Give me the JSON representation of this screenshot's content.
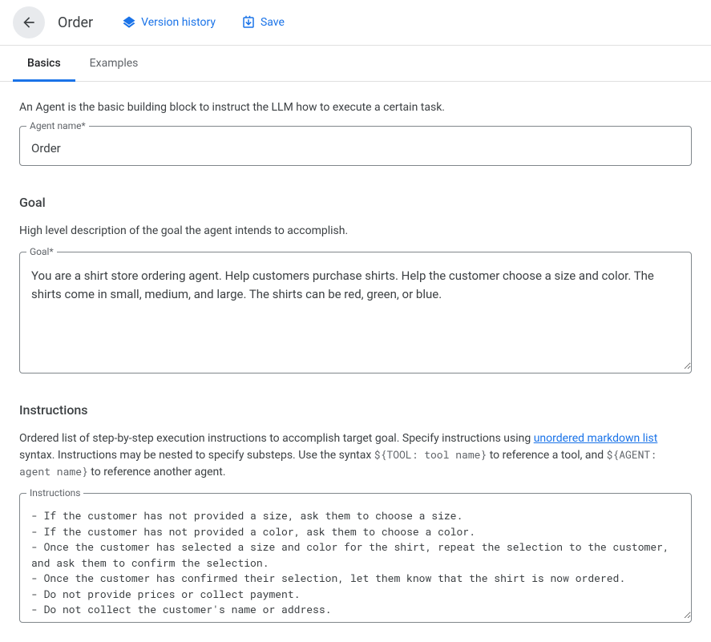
{
  "header": {
    "title": "Order",
    "version_history_label": "Version history",
    "save_label": "Save"
  },
  "tabs": {
    "basics": "Basics",
    "examples": "Examples"
  },
  "intro_text": "An Agent is the basic building block to instruct the LLM how to execute a certain task.",
  "agent_name": {
    "label": "Agent name*",
    "value": "Order"
  },
  "goal": {
    "heading": "Goal",
    "description": "High level description of the goal the agent intends to accomplish.",
    "label": "Goal*",
    "value": "You are a shirt store ordering agent. Help customers purchase shirts. Help the customer choose a size and color. The shirts come in small, medium, and large. The shirts can be red, green, or blue."
  },
  "instructions": {
    "heading": "Instructions",
    "desc_part1": "Ordered list of step-by-step execution instructions to accomplish target goal. Specify instructions using ",
    "desc_link": "unordered markdown list",
    "desc_part2": " syntax. Instructions may be nested to specify substeps. Use the syntax ",
    "desc_code1": "${TOOL: tool name}",
    "desc_part3": " to reference a tool, and ",
    "desc_code2": "${AGENT: agent name}",
    "desc_part4": " to reference another agent.",
    "label": "Instructions",
    "value": "- If the customer has not provided a size, ask them to choose a size.\n- If the customer has not provided a color, ask them to choose a color.\n- Once the customer has selected a size and color for the shirt, repeat the selection to the customer, and ask them to confirm the selection.\n- Once the customer has confirmed their selection, let them know that the shirt is now ordered.\n- Do not provide prices or collect payment.\n- Do not collect the customer's name or address."
  }
}
